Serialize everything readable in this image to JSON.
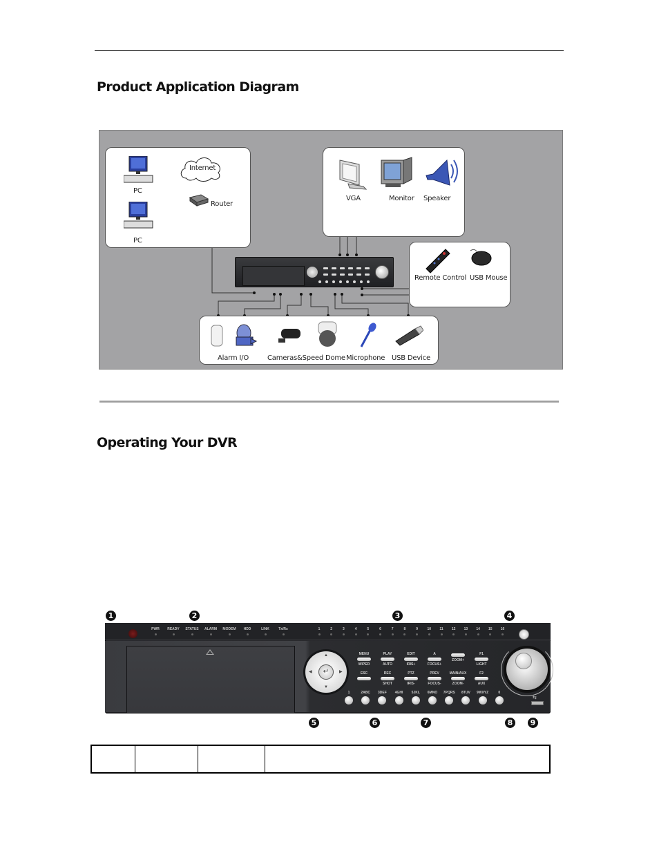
{
  "page": {
    "section1_title": "Product Application Diagram",
    "section2_title": "Operating Your DVR"
  },
  "diagram": {
    "network_panel": {
      "devices": [
        {
          "label": "PC",
          "icon": "desktop-pc-icon"
        },
        {
          "label": "PC",
          "icon": "desktop-pc-icon"
        },
        {
          "label": "Internet",
          "icon": "cloud-icon"
        },
        {
          "label": "Router",
          "icon": "router-icon"
        }
      ]
    },
    "output_panel": {
      "devices": [
        {
          "label": "VGA",
          "icon": "lcd-monitor-icon"
        },
        {
          "label": "Monitor",
          "icon": "crt-monitor-icon"
        },
        {
          "label": "Speaker",
          "icon": "speaker-icon"
        }
      ]
    },
    "control_panel": {
      "devices": [
        {
          "label": "Remote Control",
          "icon": "remote-control-icon"
        },
        {
          "label": "USB Mouse",
          "icon": "mouse-icon"
        }
      ]
    },
    "input_panel": {
      "devices": [
        {
          "label": "Alarm I/O",
          "icon": "alarm-sensor-icon"
        },
        {
          "label": "Cameras&Speed Dome",
          "icon": "camera-icon"
        },
        {
          "label": "Microphone",
          "icon": "microphone-icon"
        },
        {
          "label": "USB Device",
          "icon": "usb-drive-icon"
        }
      ]
    }
  },
  "dvr_panel": {
    "callouts_top": [
      "1",
      "2",
      "3",
      "4"
    ],
    "callouts_bottom": [
      "5",
      "6",
      "7",
      "8",
      "9"
    ],
    "status_leds": [
      "PWR",
      "READY",
      "STATUS",
      "ALARM",
      "MODEM",
      "HDD",
      "LINK",
      "Tx/Rx"
    ],
    "channel_leds": [
      "1",
      "2",
      "3",
      "4",
      "5",
      "6",
      "7",
      "8",
      "9",
      "10",
      "11",
      "12",
      "13",
      "14",
      "15",
      "16"
    ],
    "enter_symbol": "↵",
    "function_keys": [
      {
        "top": "MENU",
        "bottom": "WIPER"
      },
      {
        "top": "PLAY",
        "bottom": "AUTO"
      },
      {
        "top": "EDIT",
        "bottom": "IRIS+"
      },
      {
        "top": "A",
        "bottom": "FOCUS+"
      },
      {
        "top": "",
        "bottom": "ZOOM+"
      },
      {
        "top": "F1",
        "bottom": "LIGHT"
      },
      {
        "top": "ESC",
        "bottom": ""
      },
      {
        "top": "REC",
        "bottom": "SHOT"
      },
      {
        "top": "PTZ",
        "bottom": "IRIS-"
      },
      {
        "top": "PREV",
        "bottom": "FOCUS-"
      },
      {
        "top": "MAIN/AUX",
        "bottom": "ZOOM-"
      },
      {
        "top": "F2",
        "bottom": "AUX"
      }
    ],
    "numeric_keys": [
      "1",
      "2ABC",
      "3DEF",
      "4GHI",
      "5JKL",
      "6MNO",
      "7PQRS",
      "8TUV",
      "9WXYZ",
      "0"
    ]
  },
  "table": {
    "rows": [
      [
        "",
        "",
        "",
        ""
      ]
    ]
  }
}
